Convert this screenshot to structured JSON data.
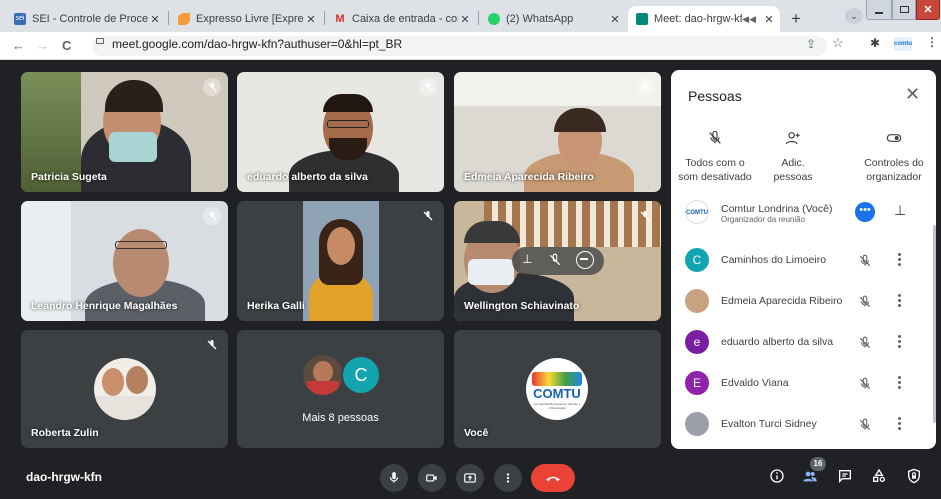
{
  "browser": {
    "tabs": [
      {
        "title": "SEI - Controle de Processos",
        "close": "✕",
        "icon_color": "#3b6db3"
      },
      {
        "title": "Expresso Livre [Expresso M",
        "close": "✕",
        "icon_color": "#f29d3a"
      },
      {
        "title": "Caixa de entrada - comturi",
        "close": "✕",
        "icon_color": "#d93025"
      },
      {
        "title": "(2) WhatsApp",
        "close": "✕",
        "icon_color": "#25d366"
      },
      {
        "title": "Meet: dao-hrgw-kfn",
        "close": "✕",
        "icon_color": "#00897b"
      }
    ],
    "sei_badge": "sei",
    "gmail_badge": "M",
    "new_tab": "+",
    "url": "meet.google.com/dao-hrgw-kfn?authuser=0&hl=pt_BR",
    "back": "←",
    "forward": "→",
    "reload": "C",
    "profile_label": "comtu"
  },
  "tiles": [
    {
      "name": "Patricia Sugeta"
    },
    {
      "name": "eduardo alberto da silva"
    },
    {
      "name": "Edmeia Aparecida Ribeiro"
    },
    {
      "name": "Leandro Henrique Magalhães"
    },
    {
      "name": "Herika Galli"
    },
    {
      "name": "Wellington Schiavinato"
    },
    {
      "name": "Roberta Zulin"
    },
    {
      "name": "Mais 8 pessoas",
      "avatar_letter": "C"
    },
    {
      "name": "Você",
      "logo_text": "COMTU",
      "logo_sub": "Companhia Municipal de Trânsito e Urbanização"
    }
  ],
  "panel": {
    "title": "Pessoas",
    "close": "✕",
    "actions": [
      {
        "label": "Todos com o som desativado"
      },
      {
        "label": "Adic. pessoas"
      },
      {
        "label": "Controles do organizador"
      }
    ],
    "participants": [
      {
        "name": "Comtur Londrina (Você)",
        "subtitle": "Organizador da reunião",
        "avatar": "COMTU",
        "avatar_color": "#ffffff"
      },
      {
        "name": "Caminhos do Limoeiro",
        "avatar": "C",
        "avatar_color": "#12a4af"
      },
      {
        "name": "Edmeia Aparecida Ribeiro",
        "avatar": "",
        "avatar_color": "#c9a27f"
      },
      {
        "name": "eduardo alberto da silva",
        "avatar": "e",
        "avatar_color": "#7b1fa2"
      },
      {
        "name": "Edvaldo Viana",
        "avatar": "E",
        "avatar_color": "#8e24aa"
      },
      {
        "name": "Evalton Turci Sidney",
        "avatar": "",
        "avatar_color": "#9aa0a6"
      }
    ]
  },
  "bottom": {
    "meeting_code": "dao-hrgw-kfn",
    "participant_count": "16",
    "end_call_color": "#ea4335"
  }
}
